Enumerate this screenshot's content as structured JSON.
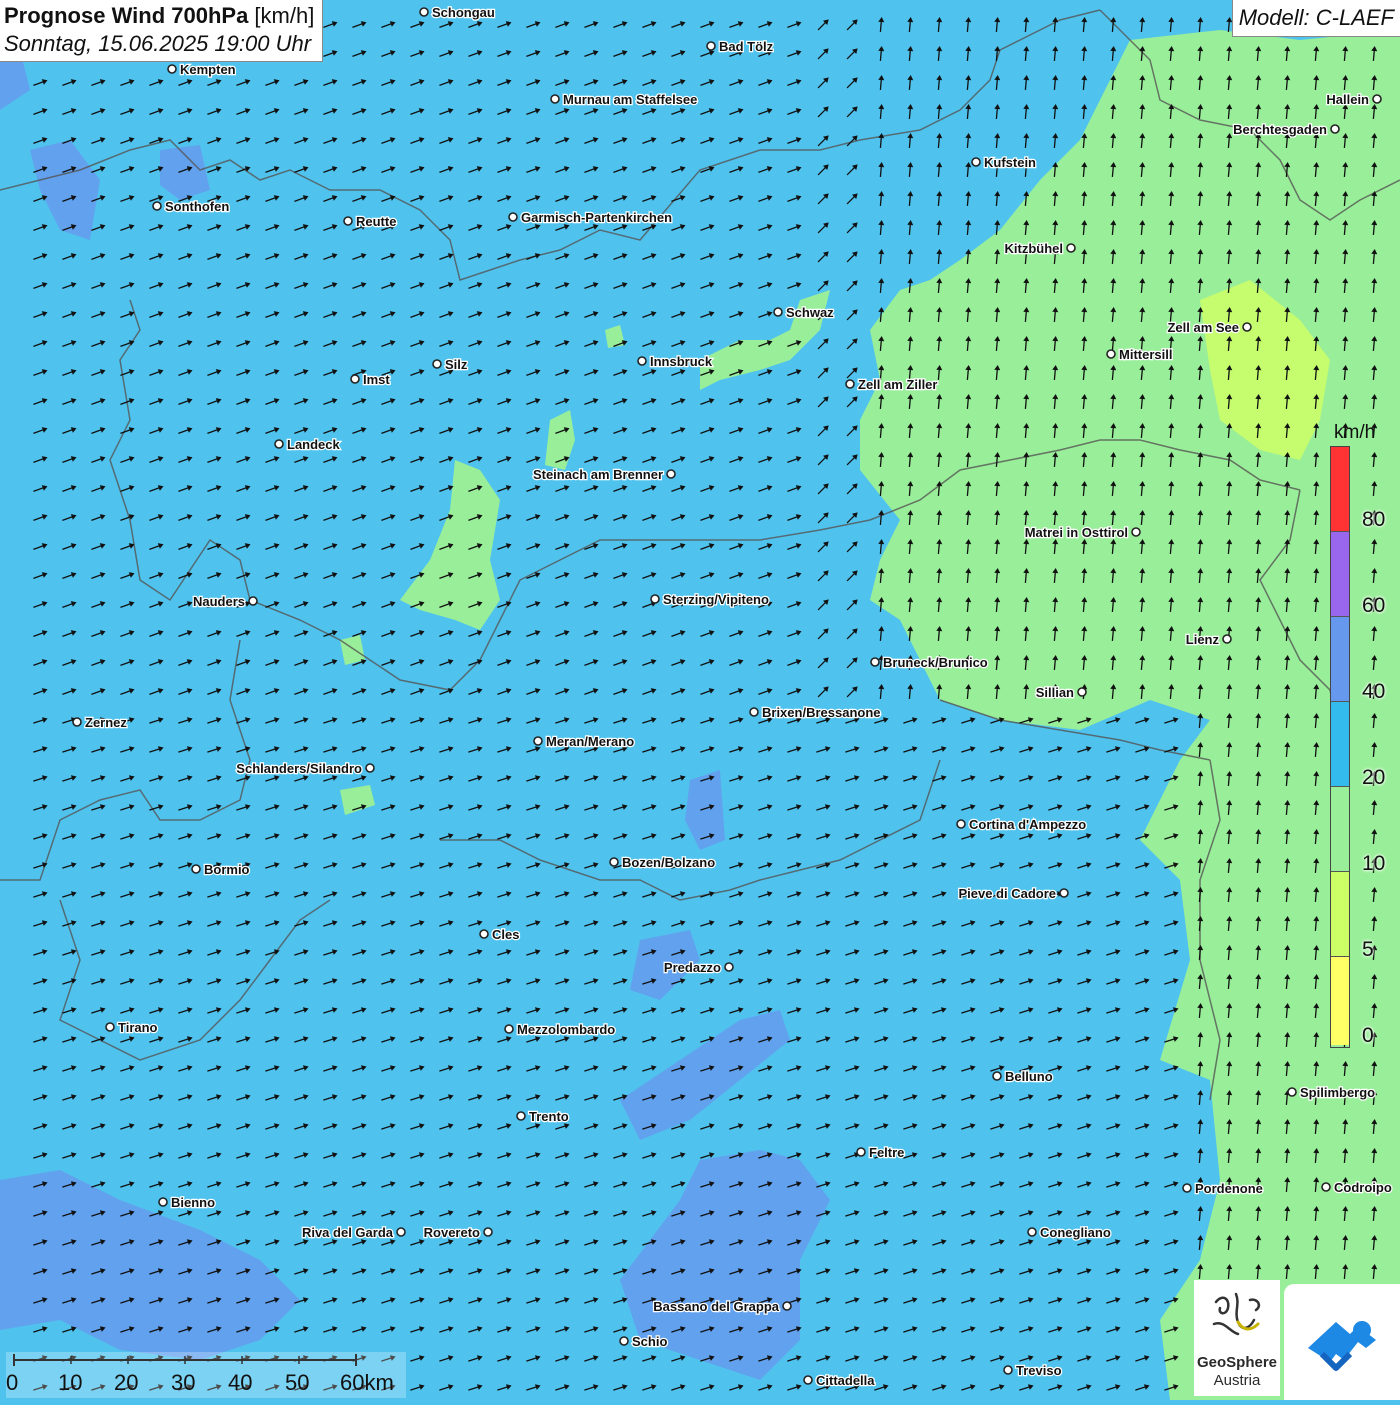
{
  "header": {
    "title_bold": "Prognose Wind 700hPa",
    "title_unit": " [km/h]",
    "subtitle": "Sonntag, 15.06.2025 19:00 Uhr"
  },
  "model_label": "Modell: C-LAEF",
  "legend": {
    "unit": "km/h",
    "bands": [
      {
        "from": 0,
        "to": 5,
        "color": "#ffff66"
      },
      {
        "from": 5,
        "to": 10,
        "color": "#ccff66"
      },
      {
        "from": 10,
        "to": 20,
        "color": "#99ee99"
      },
      {
        "from": 20,
        "to": 40,
        "color": "#4fc3ee"
      },
      {
        "from": 40,
        "to": 60,
        "color": "#6699ee"
      },
      {
        "from": 60,
        "to": 80,
        "color": "#9966ee"
      },
      {
        "from": 80,
        "to": null,
        "color": "#ff3333"
      }
    ],
    "ticks": [
      "0",
      "5",
      "10",
      "20",
      "40",
      "60",
      "80"
    ]
  },
  "scale_bar": {
    "labels": [
      "0",
      "10",
      "20",
      "30",
      "40",
      "50",
      "60km"
    ]
  },
  "logos": {
    "geosphere_line1": "GeoSphere",
    "geosphere_line2": "Austria"
  },
  "colors": {
    "wind_10_20": "#99ee99",
    "wind_20_40": "#4fc3ee",
    "wind_40_60": "#6699ee",
    "wind_5_10": "#ccff66",
    "arrow": "#111111",
    "border": "#555555",
    "brand_blue": "#1e88e5"
  },
  "wind_direction": "predominantly from the west-southwest; from the south in the eastern region",
  "cities": [
    {
      "name": "Schongau"
    },
    {
      "name": "Bad Tölz"
    },
    {
      "name": "Kempten"
    },
    {
      "name": "Murnau am Staffelsee"
    },
    {
      "name": "Hallein"
    },
    {
      "name": "Berchtesgaden"
    },
    {
      "name": "Kufstein"
    },
    {
      "name": "Sonthofen"
    },
    {
      "name": "Reutte"
    },
    {
      "name": "Garmisch-Partenkirchen"
    },
    {
      "name": "Kitzbühel"
    },
    {
      "name": "Schwaz"
    },
    {
      "name": "Zell am See"
    },
    {
      "name": "Innsbruck"
    },
    {
      "name": "Mittersill"
    },
    {
      "name": "Imst"
    },
    {
      "name": "Silz"
    },
    {
      "name": "Zell am Ziller"
    },
    {
      "name": "Landeck"
    },
    {
      "name": "Steinach am Brenner"
    },
    {
      "name": "Matrei in Osttirol"
    },
    {
      "name": "Nauders"
    },
    {
      "name": "Sterzing/Vipiteno"
    },
    {
      "name": "Lienz"
    },
    {
      "name": "Bruneck/Brunico"
    },
    {
      "name": "Sillian"
    },
    {
      "name": "Zernez"
    },
    {
      "name": "Brixen/Bressanone"
    },
    {
      "name": "Meran/Merano"
    },
    {
      "name": "Schlanders/Silandro"
    },
    {
      "name": "Cortina d'Ampezzo"
    },
    {
      "name": "Bozen/Bolzano"
    },
    {
      "name": "Bormio"
    },
    {
      "name": "Pieve di Cadore"
    },
    {
      "name": "Cles"
    },
    {
      "name": "Predazzo"
    },
    {
      "name": "Tirano"
    },
    {
      "name": "Mezzolombardo"
    },
    {
      "name": "Belluno"
    },
    {
      "name": "Spilimbergo"
    },
    {
      "name": "Trento"
    },
    {
      "name": "Feltre"
    },
    {
      "name": "Pordenone"
    },
    {
      "name": "Codroipo"
    },
    {
      "name": "Bienno"
    },
    {
      "name": "Riva del Garda"
    },
    {
      "name": "Rovereto"
    },
    {
      "name": "Conegliano"
    },
    {
      "name": "Bassano del Grappa"
    },
    {
      "name": "Schio"
    },
    {
      "name": "Treviso"
    },
    {
      "name": "Cittadella"
    }
  ]
}
